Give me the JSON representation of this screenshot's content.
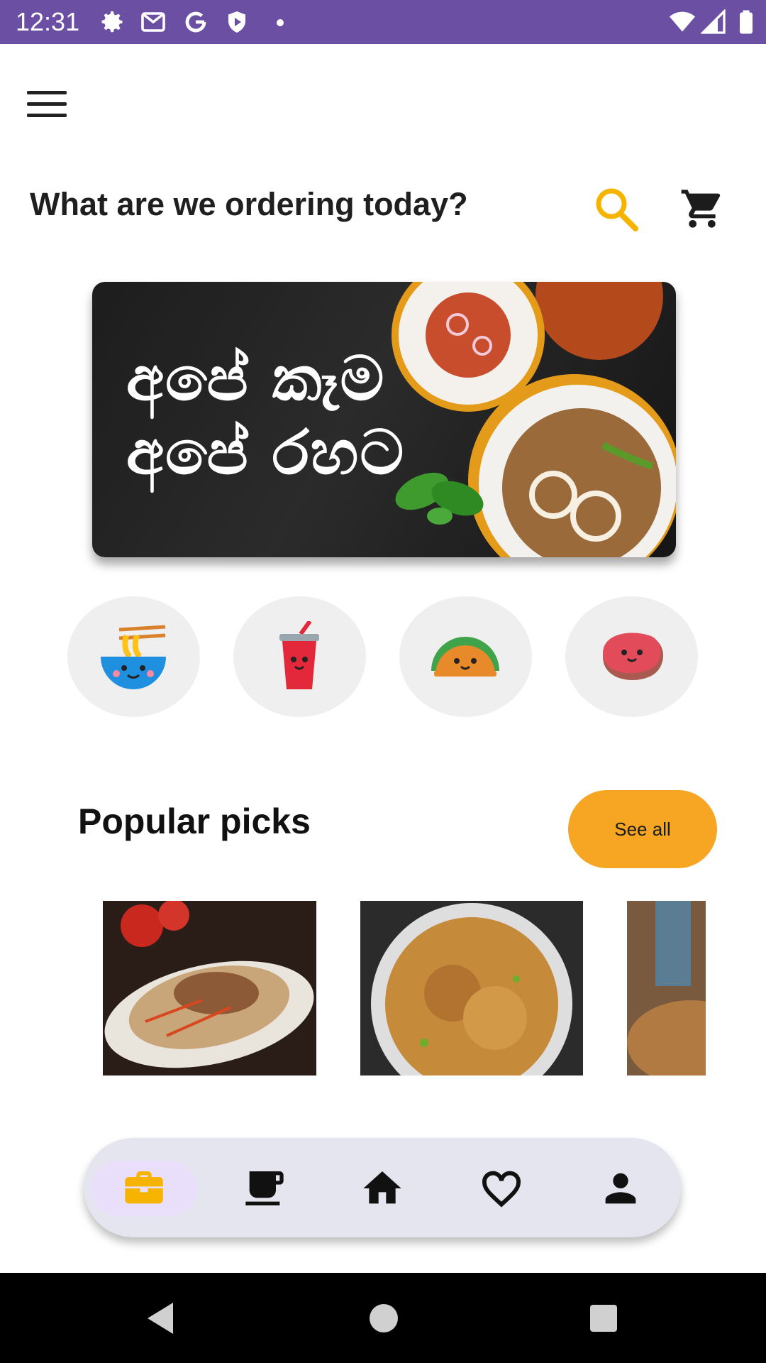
{
  "status_bar": {
    "time": "12:31",
    "background": "#6a4fa3",
    "left_icons": [
      "settings-icon",
      "gmail-icon",
      "google-icon",
      "play-protect-icon",
      "dot-icon"
    ],
    "right_icons": [
      "wifi-icon",
      "signal-icon",
      "battery-icon"
    ]
  },
  "header": {
    "headline": "What are we ordering today?",
    "search_icon": "search-icon",
    "cart_icon": "cart-icon",
    "accent": "#f6b400"
  },
  "banner": {
    "text_line1": "අපේ කෑම",
    "text_line2": "අපේ රහට"
  },
  "categories": [
    "noodles-bowl-icon",
    "drink-cup-icon",
    "taco-icon",
    "steak-icon"
  ],
  "popular": {
    "title": "Popular picks",
    "see_all_label": "See all",
    "button_color": "#f6a623"
  },
  "bottom_nav": {
    "items": [
      "briefcase-icon",
      "coffee-icon",
      "home-icon",
      "heart-icon",
      "person-icon"
    ],
    "active": "briefcase-icon"
  },
  "system_nav": [
    "back-icon",
    "home-circle-icon",
    "recents-icon"
  ]
}
